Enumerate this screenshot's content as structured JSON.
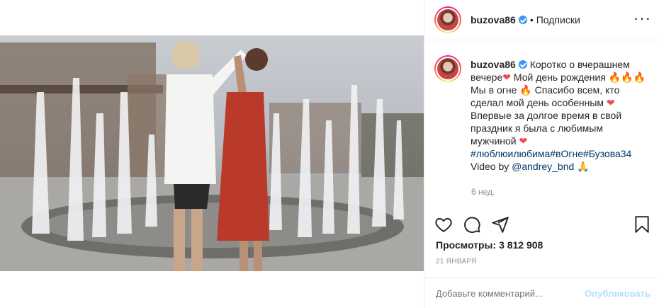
{
  "header": {
    "username": "buzova86",
    "separator": "•",
    "follow_label": "Подписки",
    "more_label": "···"
  },
  "caption": {
    "username": "buzova86",
    "line1": "Коротко о вчерашнем вечере",
    "line2": "Мой день рождения",
    "line3": "Мы в огне",
    "line4": "Спасибо всем, кто сделал мой день особенным",
    "line5": "Впервые за долгое время в свой праздник я была с любимым мужчиной",
    "hashtags": "#люблюилюбима#вОгне#Бузова34",
    "video_by": "Video by",
    "mention": "@andrey_bnd",
    "emoji_heart": "❤",
    "emoji_fire": "🔥",
    "emoji_pray": "🙏"
  },
  "meta": {
    "time_ago": "6 нед.",
    "views_label": "Просмотры:",
    "views_value": "3 812 908",
    "date": "21 ЯНВАРЯ"
  },
  "comment_bar": {
    "placeholder": "Добавьте комментарий...",
    "publish_label": "Опубликовать"
  },
  "colors": {
    "link": "#00376b",
    "verified": "#3897f0",
    "muted": "#8e8e8e",
    "publish_disabled": "#b2dffc",
    "heart": "#ed4956"
  },
  "icons": [
    "verified-icon",
    "heart-icon",
    "comment-icon",
    "share-icon",
    "bookmark-icon",
    "more-icon"
  ]
}
